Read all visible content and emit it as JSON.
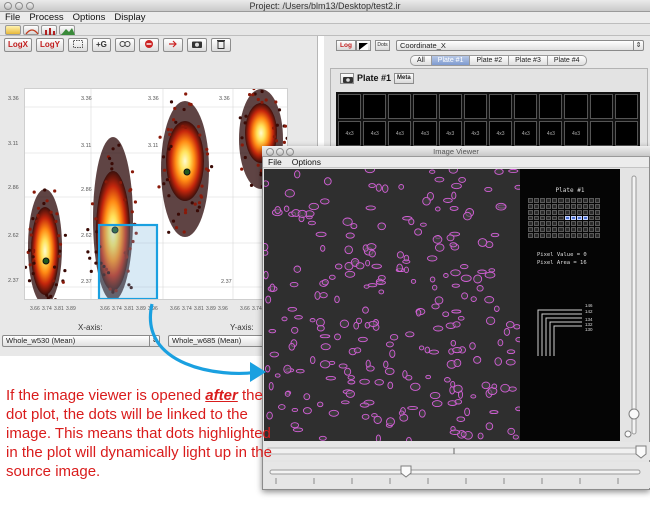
{
  "main_window": {
    "title": "Project: /Users/blm13/Desktop/test2.ir",
    "menu": [
      "File",
      "Process",
      "Options",
      "Display"
    ]
  },
  "plot_toolbar": {
    "buttons": [
      "LogX",
      "LogY",
      "",
      "+G",
      "",
      "",
      "",
      "",
      ""
    ]
  },
  "plot": {
    "y_ticks": [
      "3.36",
      "3.11",
      "2.86",
      "2.62",
      "2.37"
    ],
    "inner_labels": [
      "3.36",
      "3.36",
      "3.36",
      "3.11",
      "3.11",
      "2.86",
      "2.62",
      "2.37",
      "2.37"
    ],
    "x_ticks": [
      "3.66",
      "3.74",
      "3.81",
      "3.89",
      "3.96"
    ],
    "x_axis_label": "X-axis:",
    "y_axis_label": "Y-axis:",
    "x_select": "Whole_w530 (Mean)",
    "y_select": "Whole_w685 (Mean)"
  },
  "right_panel": {
    "log_button": "Log",
    "dots_button": "Dots",
    "coordinate_select": "Coordinate_X",
    "tabs": [
      "All",
      "Plate #1",
      "Plate #2",
      "Plate #3",
      "Plate #4"
    ],
    "selected_tab": "Plate #1",
    "plate_title": "Plate #1",
    "meta_button": "Meta",
    "well_label": "4x3"
  },
  "image_viewer": {
    "title": "Image Viewer",
    "menu": [
      "File",
      "Options"
    ],
    "plate_label": "Plate #1",
    "pixel_value": "Pixel Value = 0",
    "pixel_area": "Pixel Area = 16",
    "scale_labels": [
      "146",
      "142",
      "134",
      "132",
      "130"
    ]
  },
  "annotation": {
    "line1_pre": "If the image viewer is opened ",
    "line1_emph": "after",
    "rest": "the dot plot, the dots will be linked to the image.  This means that dots highlighted in the plot will dynamically light up in the source image."
  },
  "colors": {
    "annotation_red": "#d91c1c",
    "highlight_blue": "#1aa0e0",
    "outline_magenta": "#d45fd8",
    "selected_well": "#4a6fd0"
  }
}
